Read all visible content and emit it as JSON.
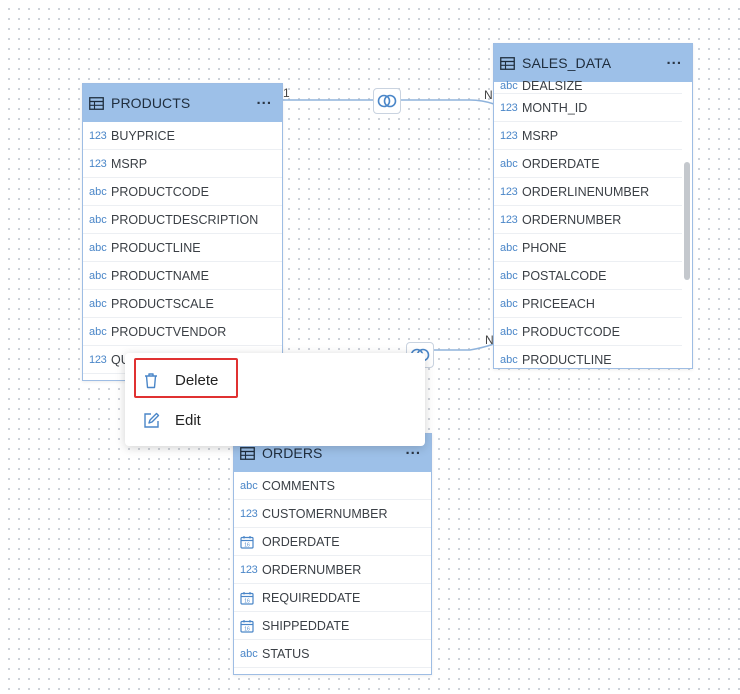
{
  "relations": [
    {
      "left_card": "1",
      "right_card": "N"
    },
    {
      "right_card": "N"
    }
  ],
  "tables": {
    "products": {
      "name": "PRODUCTS",
      "fields": [
        {
          "type": "123",
          "name": "BUYPRICE"
        },
        {
          "type": "123",
          "name": "MSRP"
        },
        {
          "type": "abc",
          "name": "PRODUCTCODE"
        },
        {
          "type": "abc",
          "name": "PRODUCTDESCRIPTION"
        },
        {
          "type": "abc",
          "name": "PRODUCTLINE"
        },
        {
          "type": "abc",
          "name": "PRODUCTNAME"
        },
        {
          "type": "abc",
          "name": "PRODUCTSCALE"
        },
        {
          "type": "abc",
          "name": "PRODUCTVENDOR"
        },
        {
          "type": "123",
          "name": "QU"
        }
      ]
    },
    "sales_data": {
      "name": "SALES_DATA",
      "fields": [
        {
          "type": "abc",
          "name": "DEALSIZE"
        },
        {
          "type": "123",
          "name": "MONTH_ID"
        },
        {
          "type": "123",
          "name": "MSRP"
        },
        {
          "type": "abc",
          "name": "ORDERDATE"
        },
        {
          "type": "123",
          "name": "ORDERLINENUMBER"
        },
        {
          "type": "123",
          "name": "ORDERNUMBER"
        },
        {
          "type": "abc",
          "name": "PHONE"
        },
        {
          "type": "abc",
          "name": "POSTALCODE"
        },
        {
          "type": "abc",
          "name": "PRICEEACH"
        },
        {
          "type": "abc",
          "name": "PRODUCTCODE"
        },
        {
          "type": "abc",
          "name": "PRODUCTLINE"
        }
      ]
    },
    "orders": {
      "name": "ORDERS",
      "fields": [
        {
          "type": "abc",
          "name": "COMMENTS"
        },
        {
          "type": "123",
          "name": "CUSTOMERNUMBER"
        },
        {
          "type": "date",
          "name": "ORDERDATE"
        },
        {
          "type": "123",
          "name": "ORDERNUMBER"
        },
        {
          "type": "date",
          "name": "REQUIREDDATE"
        },
        {
          "type": "date",
          "name": "SHIPPEDDATE"
        },
        {
          "type": "abc",
          "name": "STATUS"
        }
      ]
    }
  },
  "context_menu": {
    "items": [
      {
        "label": "Delete",
        "icon": "trash-icon"
      },
      {
        "label": "Edit",
        "icon": "edit-icon"
      }
    ]
  },
  "colors": {
    "table_header": "#9dc0e8",
    "type_tag": "#4a86c8",
    "highlight": "#e03131",
    "connector": "#8fb3dc"
  }
}
